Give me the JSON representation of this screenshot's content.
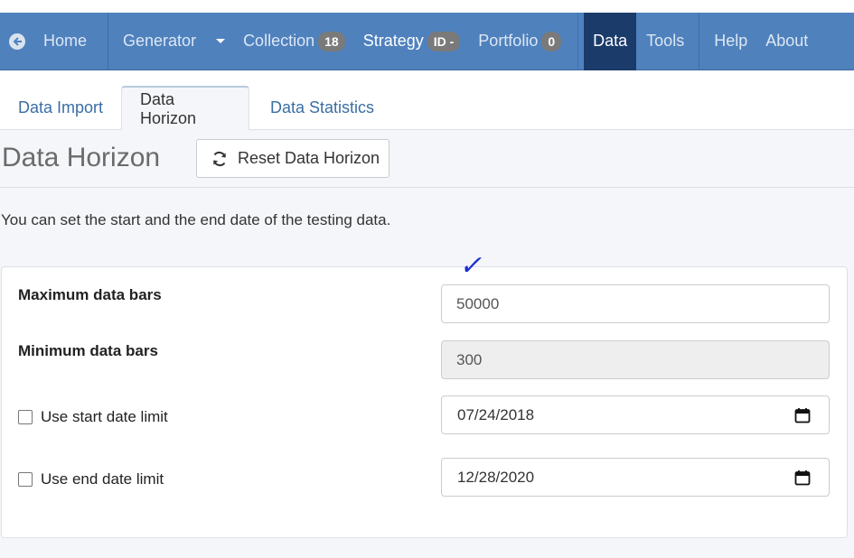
{
  "navbar": {
    "home": "Home",
    "generator": "Generator",
    "collection": "Collection",
    "collection_count": "18",
    "strategy": "Strategy",
    "strategy_id": "ID -",
    "portfolio": "Portfolio",
    "portfolio_count": "0",
    "data": "Data",
    "tools": "Tools",
    "help": "Help",
    "about": "About"
  },
  "tabs": [
    {
      "label": "Data Import"
    },
    {
      "label": "Data Horizon"
    },
    {
      "label": "Data Statistics"
    }
  ],
  "page": {
    "title": "Data Horizon",
    "reset_button": "Reset Data Horizon",
    "description": "You can set the start and the end date of the testing data."
  },
  "form": {
    "max_bars_label": "Maximum data bars",
    "max_bars_value": "50000",
    "min_bars_label": "Minimum data bars",
    "min_bars_value": "300",
    "start_limit_label": "Use start date limit",
    "start_date": "07/24/2018",
    "end_limit_label": "Use end date limit",
    "end_date": "12/28/2020",
    "annotation": "✓"
  },
  "colors": {
    "navbar": "#4f81bd",
    "active_nav": "#1b3b6b",
    "link": "#3a6ea5",
    "annotation": "#1a2fd0"
  }
}
